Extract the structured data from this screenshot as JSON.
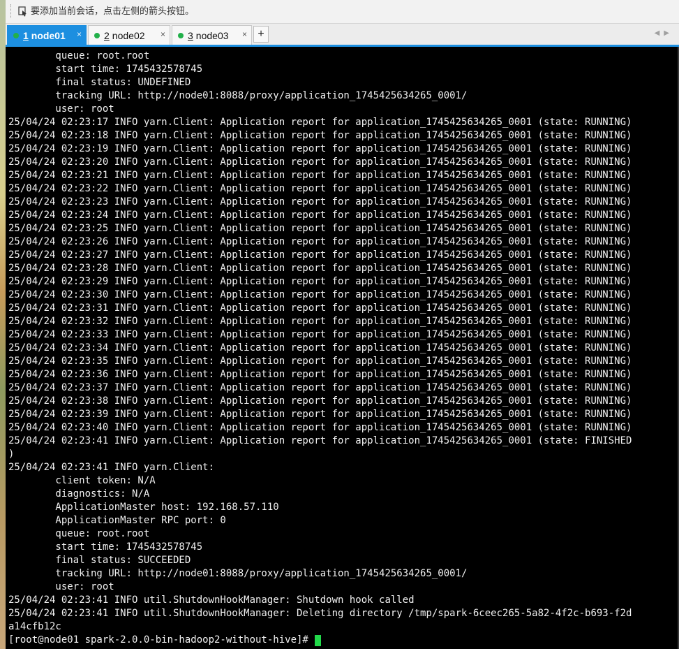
{
  "toolbar": {
    "hint": "要添加当前会话，点击左侧的箭头按钮。"
  },
  "tabs": [
    {
      "num": "1",
      "name": "node01",
      "active": true
    },
    {
      "num": "2",
      "name": "node02",
      "active": false
    },
    {
      "num": "3",
      "name": "node03",
      "active": false
    }
  ],
  "tab_close_glyph": "×",
  "add_tab_label": "+",
  "status_color": "#22b04a",
  "accent_color": "#1d8fe0",
  "terminal": {
    "lines": [
      "        queue: root.root",
      "        start time: 1745432578745",
      "        final status: UNDEFINED",
      "        tracking URL: http://node01:8088/proxy/application_1745425634265_0001/",
      "        user: root",
      "25/04/24 02:23:17 INFO yarn.Client: Application report for application_1745425634265_0001 (state: RUNNING)",
      "25/04/24 02:23:18 INFO yarn.Client: Application report for application_1745425634265_0001 (state: RUNNING)",
      "25/04/24 02:23:19 INFO yarn.Client: Application report for application_1745425634265_0001 (state: RUNNING)",
      "25/04/24 02:23:20 INFO yarn.Client: Application report for application_1745425634265_0001 (state: RUNNING)",
      "25/04/24 02:23:21 INFO yarn.Client: Application report for application_1745425634265_0001 (state: RUNNING)",
      "25/04/24 02:23:22 INFO yarn.Client: Application report for application_1745425634265_0001 (state: RUNNING)",
      "25/04/24 02:23:23 INFO yarn.Client: Application report for application_1745425634265_0001 (state: RUNNING)",
      "25/04/24 02:23:24 INFO yarn.Client: Application report for application_1745425634265_0001 (state: RUNNING)",
      "25/04/24 02:23:25 INFO yarn.Client: Application report for application_1745425634265_0001 (state: RUNNING)",
      "25/04/24 02:23:26 INFO yarn.Client: Application report for application_1745425634265_0001 (state: RUNNING)",
      "25/04/24 02:23:27 INFO yarn.Client: Application report for application_1745425634265_0001 (state: RUNNING)",
      "25/04/24 02:23:28 INFO yarn.Client: Application report for application_1745425634265_0001 (state: RUNNING)",
      "25/04/24 02:23:29 INFO yarn.Client: Application report for application_1745425634265_0001 (state: RUNNING)",
      "25/04/24 02:23:30 INFO yarn.Client: Application report for application_1745425634265_0001 (state: RUNNING)",
      "25/04/24 02:23:31 INFO yarn.Client: Application report for application_1745425634265_0001 (state: RUNNING)",
      "25/04/24 02:23:32 INFO yarn.Client: Application report for application_1745425634265_0001 (state: RUNNING)",
      "25/04/24 02:23:33 INFO yarn.Client: Application report for application_1745425634265_0001 (state: RUNNING)",
      "25/04/24 02:23:34 INFO yarn.Client: Application report for application_1745425634265_0001 (state: RUNNING)",
      "25/04/24 02:23:35 INFO yarn.Client: Application report for application_1745425634265_0001 (state: RUNNING)",
      "25/04/24 02:23:36 INFO yarn.Client: Application report for application_1745425634265_0001 (state: RUNNING)",
      "25/04/24 02:23:37 INFO yarn.Client: Application report for application_1745425634265_0001 (state: RUNNING)",
      "25/04/24 02:23:38 INFO yarn.Client: Application report for application_1745425634265_0001 (state: RUNNING)",
      "25/04/24 02:23:39 INFO yarn.Client: Application report for application_1745425634265_0001 (state: RUNNING)",
      "25/04/24 02:23:40 INFO yarn.Client: Application report for application_1745425634265_0001 (state: RUNNING)",
      "25/04/24 02:23:41 INFO yarn.Client: Application report for application_1745425634265_0001 (state: FINISHED",
      ")",
      "25/04/24 02:23:41 INFO yarn.Client:",
      "        client token: N/A",
      "        diagnostics: N/A",
      "        ApplicationMaster host: 192.168.57.110",
      "        ApplicationMaster RPC port: 0",
      "        queue: root.root",
      "        start time: 1745432578745",
      "        final status: SUCCEEDED",
      "        tracking URL: http://node01:8088/proxy/application_1745425634265_0001/",
      "        user: root",
      "25/04/24 02:23:41 INFO util.ShutdownHookManager: Shutdown hook called",
      "25/04/24 02:23:41 INFO util.ShutdownHookManager: Deleting directory /tmp/spark-6ceec265-5a82-4f2c-b693-f2d",
      "a14cfb12c"
    ],
    "prompt": "[root@node01 spark-2.0.0-bin-hadoop2-without-hive]#",
    "cursor_color": "#22d94a"
  }
}
